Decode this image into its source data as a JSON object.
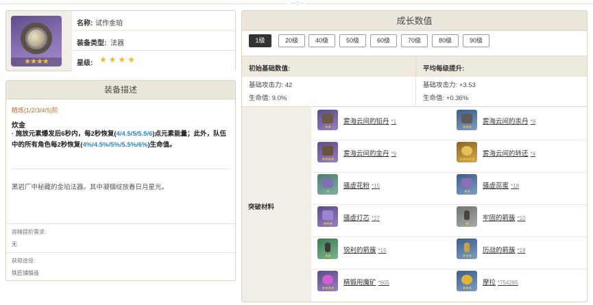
{
  "info": {
    "name_label": "名称:",
    "name_value": "试作金珀",
    "type_label": "装备类型:",
    "type_value": "法器",
    "rarity_label": "星级:",
    "rarity_stars": "★★★★",
    "portrait_stars": "★★★★"
  },
  "description": {
    "title": "装备描述",
    "refinement": "精炼(1/2/3/4/5)阶",
    "skill_name": "炊金",
    "skill_text_1": "· 施放元素爆发后6秒内，每2秒恢复(",
    "skill_hl_1": "4/4.5/5/5.5/6",
    "skill_text_2": ")点元素能量；此外，队伍中的所有角色每2秒恢复(",
    "skill_hl_2": "4%/4.5%/5%/5.5%/6%",
    "skill_text_3": ")生命值。",
    "flavor": "黑岩厂中秘藏的金珀法器。其中凝锢绽放春日月星光。",
    "upgrade_label": "容精提阶需求:",
    "upgrade_value": "无",
    "source_label": "获取途径:",
    "source_value": "铁匠铺锻造"
  },
  "growth": {
    "title": "成长数值",
    "levels": [
      "1级",
      "20级",
      "40级",
      "50级",
      "60级",
      "70级",
      "80级",
      "90级"
    ],
    "active_level": "1级",
    "base_header": "初始基础数值:",
    "avg_header": "平均每级提升:",
    "base_atk": "基础攻击力: 42",
    "base_hp": "生命值: 9.0%",
    "avg_atk": "基础攻击力: +3.53",
    "avg_hp": "生命值: +0.36%",
    "materials_label": "突破材料",
    "materials": [
      {
        "name": "雾海云间的铅丹",
        "count": "*1"
      },
      {
        "name": "雾海云间的汞丹",
        "count": "*9"
      },
      {
        "name": "雾海云间的金丹",
        "count": "*9"
      },
      {
        "name": "雾海云间的转还",
        "count": "*4"
      },
      {
        "name": "骚虚花粉",
        "count": "*15"
      },
      {
        "name": "骚虚蕊蜜",
        "count": "*18"
      },
      {
        "name": "骚虚灯芯",
        "count": "*27"
      },
      {
        "name": "牢固的箭簇",
        "count": "*10"
      },
      {
        "name": "锐利的箭簇",
        "count": "*15"
      },
      {
        "name": "历战的箭簇",
        "count": "*18"
      },
      {
        "name": "精锻用魔矿",
        "count": "*605"
      },
      {
        "name": "摩拉",
        "count": "*754265"
      }
    ]
  },
  "colors": {
    "accent_blue": "#2f86c4",
    "refine_orange": "#b86a2e",
    "star_gold": "#f0b928",
    "header_bg": "#ece7dc",
    "active_level_bg": "#333333"
  }
}
